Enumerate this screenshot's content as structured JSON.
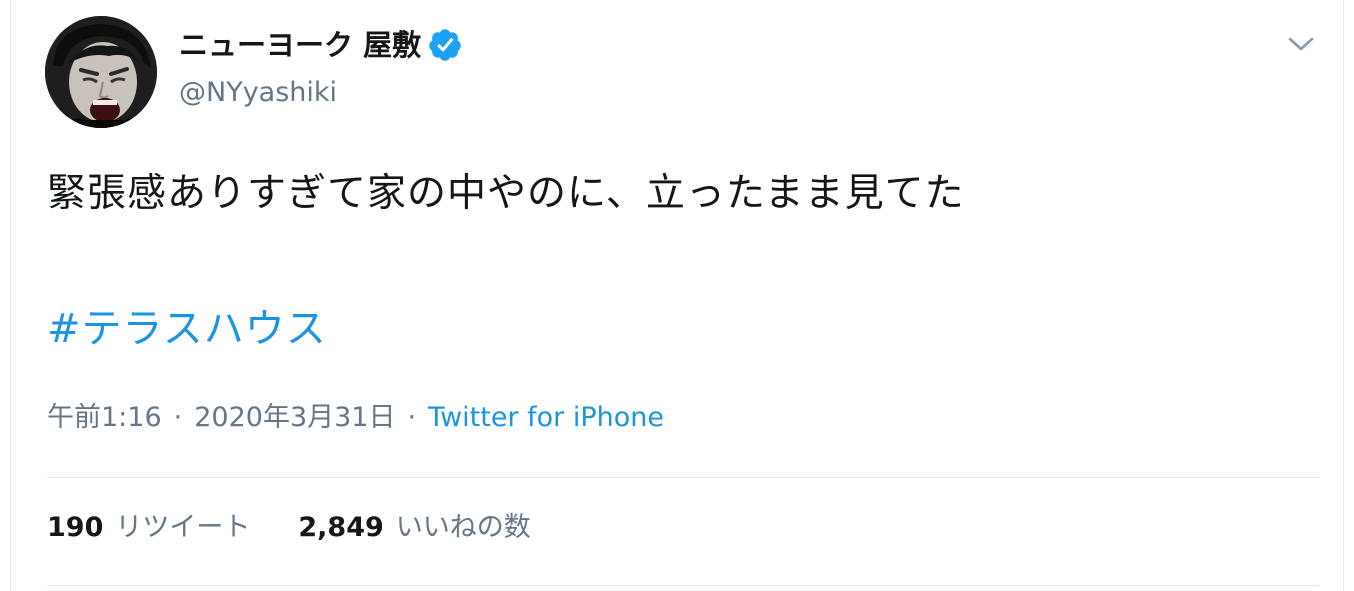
{
  "user": {
    "display_name": "ニューヨーク 屋敷",
    "handle": "@NYyashiki",
    "verified_icon": "verified-badge-icon",
    "avatar_icon": "profile-avatar"
  },
  "menu": {
    "caret_icon": "chevron-down-icon"
  },
  "tweet": {
    "text": "緊張感ありすぎて家の中やのに、立ったまま見てた",
    "hashtag": "#テラスハウス"
  },
  "meta": {
    "time": "午前1:16",
    "separator": "·",
    "date": "2020年3月31日",
    "source": "Twitter for iPhone"
  },
  "stats": {
    "retweets_count": "190",
    "retweets_label": "リツイート",
    "likes_count": "2,849",
    "likes_label": "いいねの数"
  },
  "colors": {
    "link": "#1b95e0",
    "secondary_text": "#657786",
    "primary_text": "#14171a",
    "divider": "#e1e8ed",
    "verified": "#1da1f2"
  }
}
